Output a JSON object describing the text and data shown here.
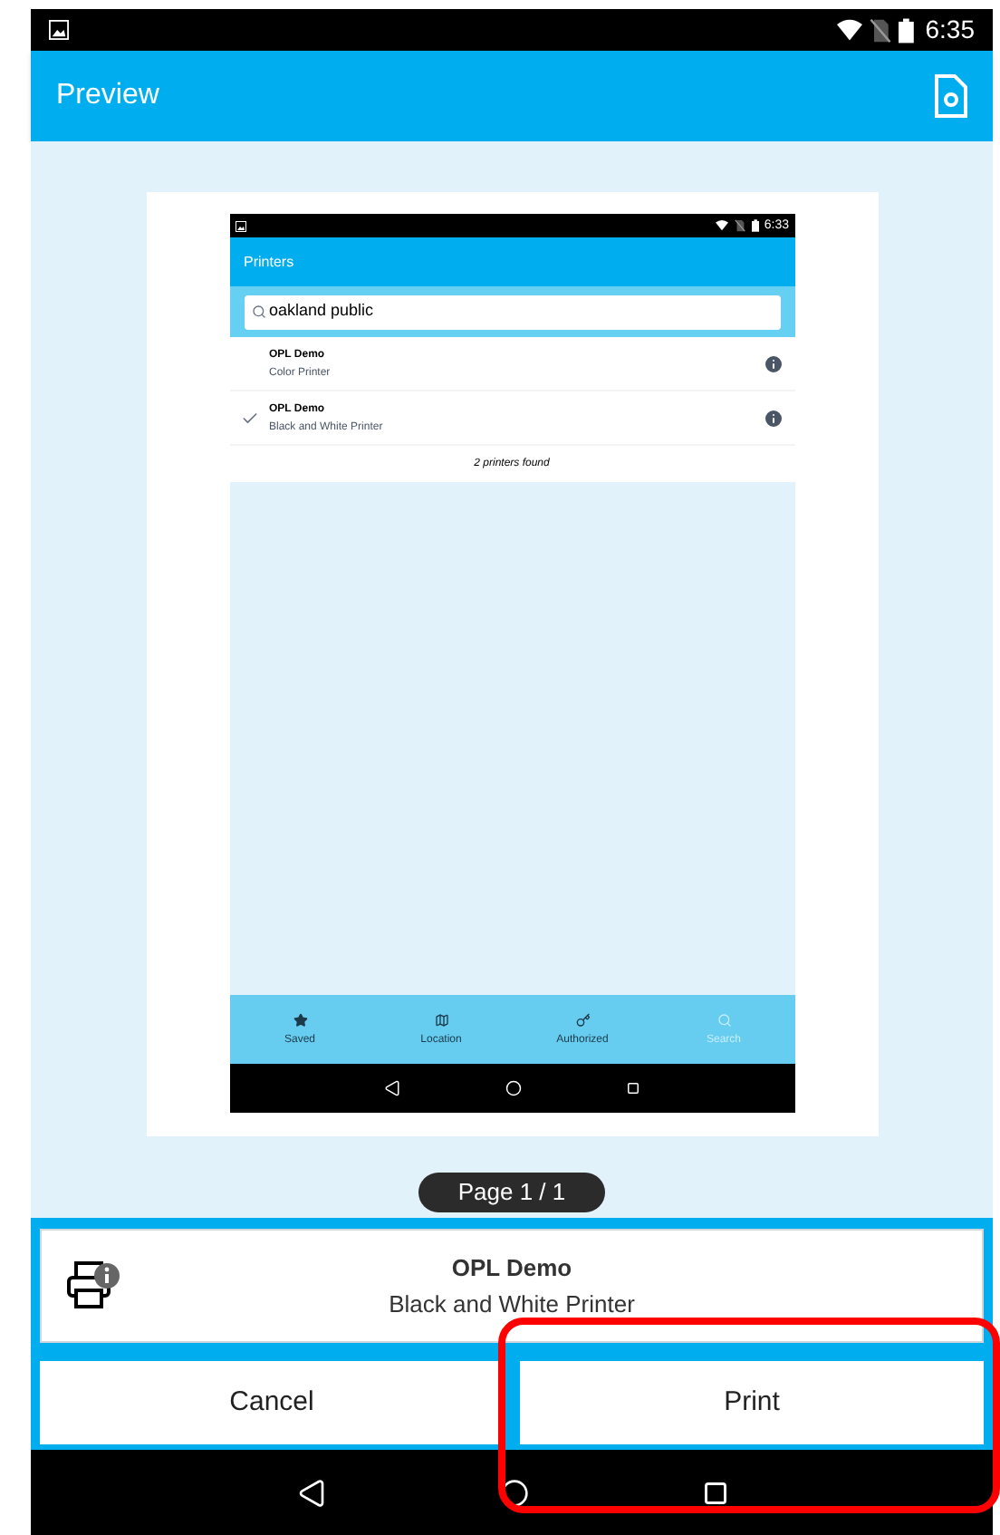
{
  "status_bar": {
    "time": "6:35"
  },
  "app_bar": {
    "title": "Preview"
  },
  "preview": {
    "status_bar": {
      "time": "6:33"
    },
    "app_bar": {
      "title": "Printers"
    },
    "search": {
      "value": "oakland public"
    },
    "printers": [
      {
        "name": "OPL Demo",
        "type": "Color Printer",
        "selected": false
      },
      {
        "name": "OPL Demo",
        "type": "Black and White Printer",
        "selected": true
      }
    ],
    "found_text": "2 printers found",
    "bottom_tabs": [
      {
        "label": "Saved",
        "selected": false
      },
      {
        "label": "Location",
        "selected": false
      },
      {
        "label": "Authorized",
        "selected": false
      },
      {
        "label": "Search",
        "selected": true
      }
    ]
  },
  "page_indicator": "Page 1 / 1",
  "printer_card": {
    "name": "OPL Demo",
    "type": "Black and White Printer"
  },
  "buttons": [
    {
      "label": "Cancel",
      "highlighted": false
    },
    {
      "label": "Print",
      "highlighted": true
    }
  ]
}
